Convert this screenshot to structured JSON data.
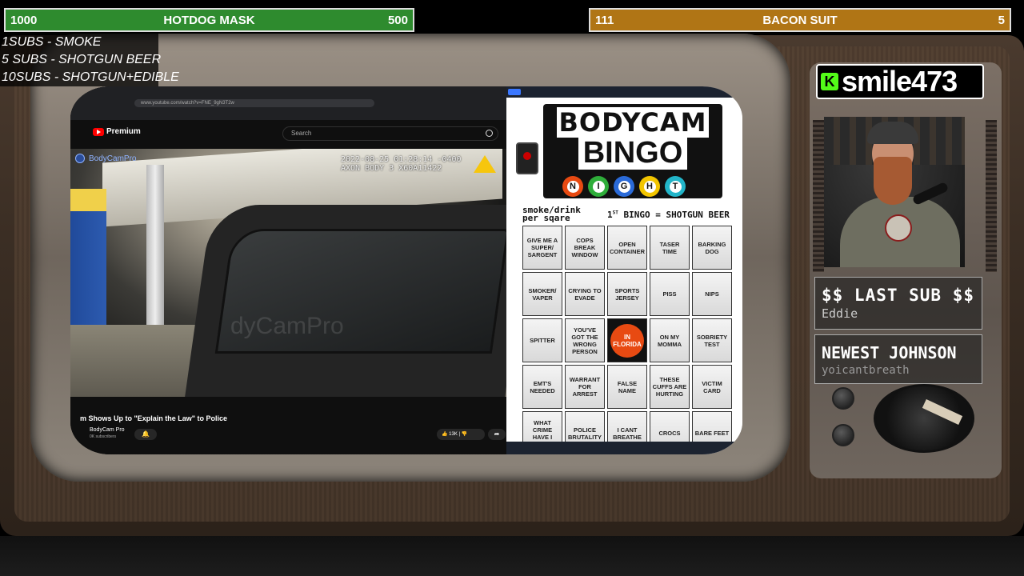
{
  "goals": {
    "left": {
      "current": "1000",
      "title": "HOTDOG MASK",
      "target": "500"
    },
    "right": {
      "current": "111",
      "title": "BACON SUIT",
      "target": "5"
    }
  },
  "sub_rewards": [
    "1SUBS   - SMOKE",
    "5 SUBS  - SHOTGUN BEER",
    "10SUBS - SHOTGUN+EDIBLE"
  ],
  "browser": {
    "url": "www.youtube.com/watch?v=FNE_9gN3T2w"
  },
  "youtube": {
    "logo": "Premium",
    "search_placeholder": "Search",
    "channel_watermark": "BodyCamPro",
    "timestamp_line1": "2022-08-25 01:28:14 -0400",
    "timestamp_line2": "AXON BODY 3 X60A11422",
    "center_watermark": "dyCamPro",
    "video_title": "m Shows Up to \"Explain the Law\" to Police",
    "channel_name": "BodyCam Pro",
    "subscribers": "0K subscribers",
    "likes": "13K"
  },
  "bingo": {
    "title_line1": "BODYCAM",
    "title_line2": "BINGO",
    "balls": [
      "N",
      "I",
      "G",
      "H",
      "T"
    ],
    "ball_colors": [
      "#e84a12",
      "#2fae3a",
      "#2a6ad8",
      "#f2c500",
      "#22b5c9"
    ],
    "smoke_line1": "smoke/drink",
    "smoke_line2": "per sqare",
    "first_bingo_prefix": "1",
    "first_bingo_sup": "ST",
    "first_bingo_text": " BINGO = SHOTGUN BEER",
    "cells": [
      "GIVE ME A SUPER/ SARGENT",
      "COPS BREAK WINDOW",
      "OPEN CONTAINER",
      "TASER TIME",
      "BARKING DOG",
      "SMOKER/ VAPER",
      "CRYING TO EVADE",
      "SPORTS JERSEY",
      "PISS",
      "NIPS",
      "SPITTER",
      "YOU'VE GOT THE WRONG PERSON",
      "IN FLORIDA",
      "ON MY MOMMA",
      "SOBRIETY TEST",
      "EMT'S NEEDED",
      "WARRANT FOR ARREST",
      "FALSE NAME",
      "THESE CUFFS ARE HURTING",
      "VICTIM CARD",
      "WHAT CRIME HAVE I COMMITED",
      "POLICE BRUTALITY",
      "I CANT BREATHE",
      "CROCS",
      "BARE FEET"
    ]
  },
  "streamer": {
    "platform_icon": "K",
    "username": "smile473"
  },
  "last_sub": {
    "label": "$$ LAST SUB $$",
    "name": "Eddie"
  },
  "newest": {
    "label": "NEWEST JOHNSON",
    "name": "yoicantbreath"
  }
}
